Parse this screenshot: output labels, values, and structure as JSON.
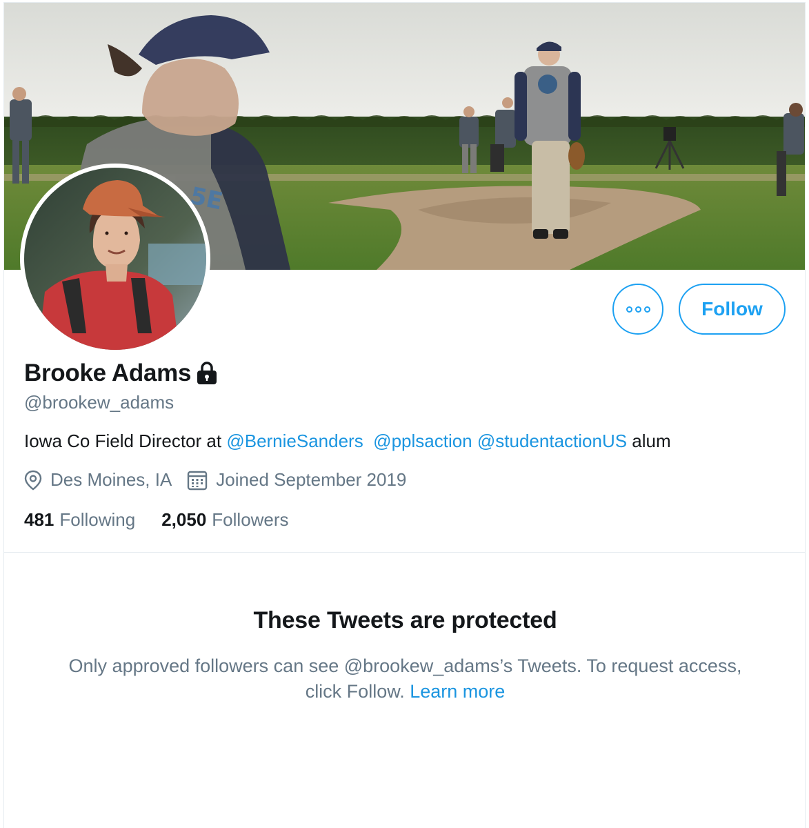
{
  "profile": {
    "display_name": "Brooke Adams",
    "handle": "@brookew_adams",
    "bio": {
      "prefix": "Iowa Co Field Director at ",
      "mentions": [
        "@BernieSanders",
        "@pplsaction",
        "@studentactionUS"
      ],
      "suffix": " alum"
    },
    "location": "Des Moines, IA",
    "joined": "Joined September 2019",
    "protected": true
  },
  "stats": {
    "following_count": "481",
    "following_label": "Following",
    "followers_count": "2,050",
    "followers_label": "Followers"
  },
  "actions": {
    "follow_label": "Follow",
    "more_icon": "more-dots-icon"
  },
  "protected_notice": {
    "title": "These Tweets are protected",
    "body_line1": "Only approved followers can see @brookew_adams’s Tweets. To request access,",
    "body_line2_prefix": "click Follow. ",
    "learn_more": "Learn more"
  },
  "icons": {
    "location": "location-pin-icon",
    "calendar": "calendar-icon",
    "lock": "lock-icon"
  },
  "colors": {
    "accent": "#1da1f2",
    "link": "#1b95e0",
    "text_primary": "#14171a",
    "text_secondary": "#657786",
    "border": "#e6ecf0"
  }
}
